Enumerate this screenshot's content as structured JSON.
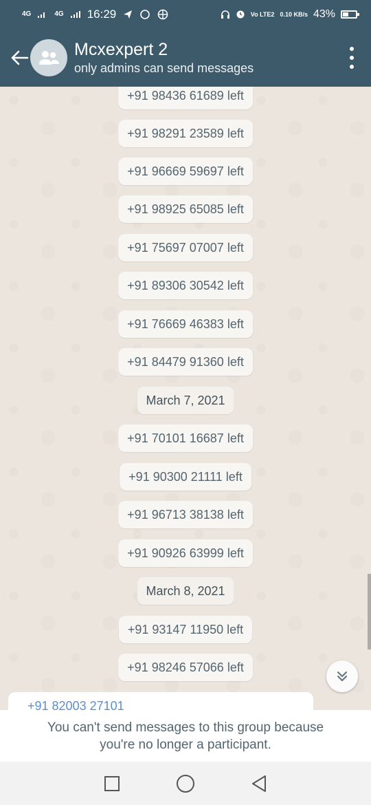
{
  "status_bar": {
    "network1": "4G",
    "network2": "4G",
    "time": "16:29",
    "volte": "Vo LTE2",
    "speed": "0.10 KB/s",
    "battery": "43%",
    "battery_level": 0.43
  },
  "header": {
    "title": "Mcxexpert 2",
    "subtitle": "only admins can send messages"
  },
  "messages": [
    {
      "type": "system",
      "text": "+91 98436 61689 left"
    },
    {
      "type": "system",
      "text": "+91 98291 23589 left"
    },
    {
      "type": "system",
      "text": "+91 96669 59697 left"
    },
    {
      "type": "system",
      "text": "+91 98925 65085 left"
    },
    {
      "type": "system",
      "text": "+91 75697 07007 left"
    },
    {
      "type": "system",
      "text": "+91 89306 30542 left"
    },
    {
      "type": "system",
      "text": "+91 76669 46383 left"
    },
    {
      "type": "system",
      "text": "+91 84479 91360 left"
    },
    {
      "type": "date",
      "text": "March 7, 2021"
    },
    {
      "type": "system",
      "text": "+91 70101 16687 left"
    },
    {
      "type": "system",
      "text": "+91 90300 21111 left"
    },
    {
      "type": "system",
      "text": "+91 96713 38138 left"
    },
    {
      "type": "system",
      "text": "+91 90926 63999 left"
    },
    {
      "type": "date",
      "text": "March 8, 2021"
    },
    {
      "type": "system",
      "text": "+91 93147 11950 left"
    },
    {
      "type": "system",
      "text": "+91 98246 57066 left"
    }
  ],
  "partial_message_sender": "+91 82003 27101",
  "notice": {
    "line1": "You can't send messages to this group because",
    "line2": "you're no longer a participant."
  },
  "icons": {
    "back": "arrow-left-icon",
    "avatar": "group-avatar-icon",
    "menu": "more-vert-icon",
    "scroll_down": "double-chevron-down-icon",
    "nav": [
      "recents-square-icon",
      "home-circle-icon",
      "back-triangle-icon"
    ]
  },
  "colors": {
    "header_bg": "#3c5a6a",
    "chat_bg": "#ece5dd",
    "bubble_bg": "#f8f6f3",
    "sender_name": "#5b8fd1"
  }
}
